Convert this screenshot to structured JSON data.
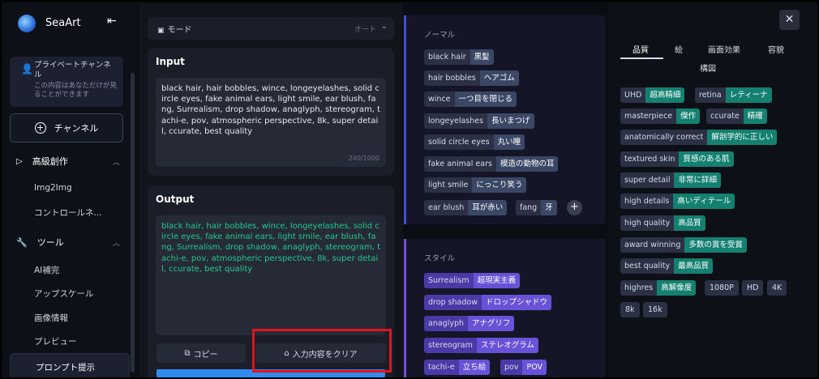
{
  "app": {
    "brand": "SeaArt",
    "collapse_icon": "collapse-left-icon"
  },
  "sidebar": {
    "private": {
      "title": "プライベートチャンネル",
      "desc": "この内容はあなただけが見ることができます"
    },
    "channel_button": "チャンネル",
    "sections": [
      {
        "label": "高級創作",
        "items": [
          "Img2Img",
          "コントロールネ..."
        ]
      },
      {
        "label": "ツール",
        "items": [
          "AI補完",
          "アップスケール",
          "画像情報",
          "プレビュー"
        ]
      }
    ],
    "active_item": "プロンプト提示"
  },
  "mode": {
    "label": "モード",
    "value": "オート"
  },
  "input": {
    "title": "Input",
    "text": "black hair, hair bobbles, wince, longeyelashes, solid circle eyes, fake animal ears, light smile, ear blush, fang, Surrealism, drop shadow, anaglyph, stereogram, tachi-e, pov, atmospheric perspective, 8k, super detail, ccurate, best quality",
    "count": "240/1000"
  },
  "output": {
    "title": "Output",
    "text": "black hair, hair bobbles, wince, longeyelashes, solid circle eyes, fake animal ears, light smile, ear blush, fang, Surrealism, drop shadow, anaglyph, stereogram, tachi-e, pov, atmospheric perspective, 8k, super detail, ccurate, best quality",
    "color": "#22c98e"
  },
  "buttons": {
    "copy": "コピー",
    "clear": "入力内容をクリア"
  },
  "normal": {
    "title": "ノーマル",
    "tags": [
      {
        "en": "black hair",
        "jp": "黒髪"
      },
      {
        "en": "hair bobbles",
        "jp": "ヘアゴム"
      },
      {
        "en": "wince",
        "jp": "一つ目を閉じる"
      },
      {
        "en": "longeyelashes",
        "jp": "長いまつげ"
      },
      {
        "en": "solid circle eyes",
        "jp": "丸い瞳"
      },
      {
        "en": "fake animal ears",
        "jp": "模造の動物の耳"
      },
      {
        "en": "light smile",
        "jp": "にっこり笑う"
      },
      {
        "en": "ear blush",
        "jp": "耳が赤い"
      },
      {
        "en": "fang",
        "jp": "牙"
      }
    ]
  },
  "style": {
    "title": "スタイル",
    "tags": [
      {
        "en": "Surrealism",
        "jp": "超現実主義"
      },
      {
        "en": "drop shadow",
        "jp": "ドロップシャドウ"
      },
      {
        "en": "anaglyph",
        "jp": "アナグリフ"
      },
      {
        "en": "stereogram",
        "jp": "ステレオグラム"
      },
      {
        "en": "tachi-e",
        "jp": "立ち絵"
      },
      {
        "en": "pov",
        "jp": "POV"
      }
    ]
  },
  "right": {
    "tabs": [
      "品質",
      "絵",
      "画面効果",
      "容貌",
      "構図"
    ],
    "quality_tags": [
      {
        "en": "UHD",
        "jp": "超高精細"
      },
      {
        "en": "retina",
        "jp": "レティーナ"
      },
      {
        "en": "masterpiece",
        "jp": "傑作"
      },
      {
        "en": "ccurate",
        "jp": "精確"
      },
      {
        "en": "anatomically correct",
        "jp": "解剖学的に正しい"
      },
      {
        "en": "textured skin",
        "jp": "質感のある肌"
      },
      {
        "en": "super detail",
        "jp": "非常に詳細"
      },
      {
        "en": "high details",
        "jp": "高いディテール"
      },
      {
        "en": "high quality",
        "jp": "高品質"
      },
      {
        "en": "award winning",
        "jp": "多数の賞を受賞"
      },
      {
        "en": "best quality",
        "jp": "最高品質"
      },
      {
        "en": "highres",
        "jp": "高解像度"
      }
    ],
    "plain_tags": [
      "1080P",
      "HD",
      "4K",
      "8k",
      "16k"
    ]
  }
}
